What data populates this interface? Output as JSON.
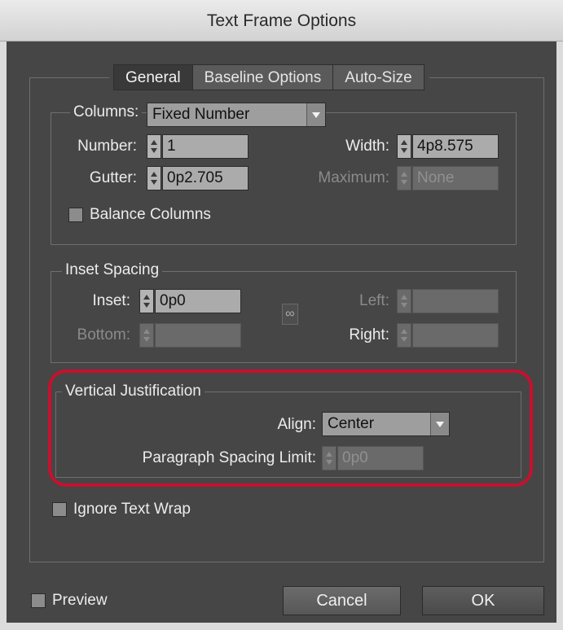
{
  "window": {
    "title": "Text Frame Options"
  },
  "tabs": [
    {
      "label": "General",
      "active": true
    },
    {
      "label": "Baseline Options",
      "active": false
    },
    {
      "label": "Auto-Size",
      "active": false
    }
  ],
  "columns": {
    "legend": "Columns:",
    "type_value": "Fixed Number",
    "number_label": "Number:",
    "number_value": "1",
    "width_label": "Width:",
    "width_value": "4p8.575",
    "gutter_label": "Gutter:",
    "gutter_value": "0p2.705",
    "maximum_label": "Maximum:",
    "maximum_value": "None",
    "balance_label": "Balance Columns",
    "balance_checked": false
  },
  "inset_spacing": {
    "legend": "Inset Spacing",
    "inset_label": "Inset:",
    "inset_value": "0p0",
    "bottom_label": "Bottom:",
    "bottom_value": "",
    "left_label": "Left:",
    "left_value": "",
    "right_label": "Right:",
    "right_value": ""
  },
  "vertical_justification": {
    "legend": "Vertical Justification",
    "align_label": "Align:",
    "align_value": "Center",
    "psl_label": "Paragraph Spacing Limit:",
    "psl_value": "0p0"
  },
  "ignore_text_wrap": {
    "label": "Ignore Text Wrap",
    "checked": false
  },
  "footer": {
    "preview_label": "Preview",
    "preview_checked": false,
    "cancel_label": "Cancel",
    "ok_label": "OK"
  },
  "colors": {
    "panel": "#464646",
    "highlight": "#c8102e",
    "field": "#ababab"
  }
}
